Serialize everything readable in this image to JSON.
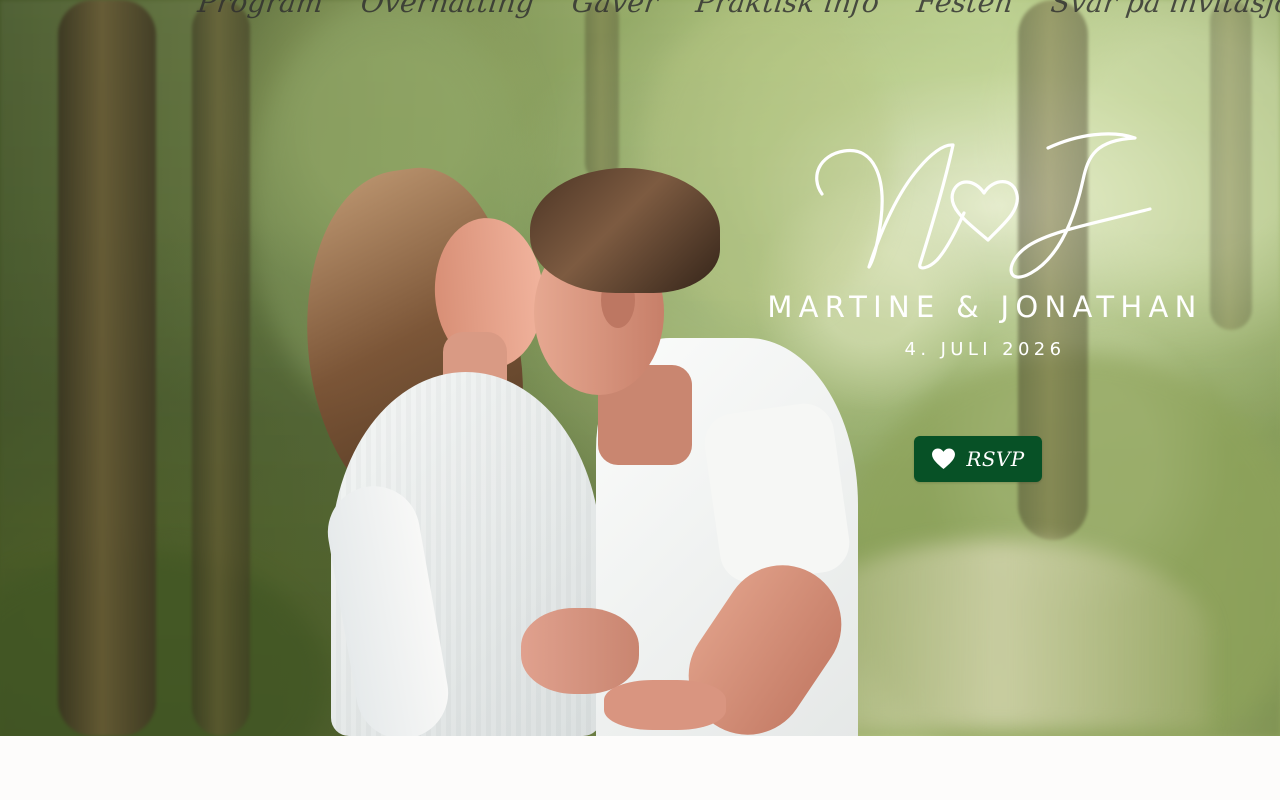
{
  "navigation": {
    "items": [
      {
        "label": "Program"
      },
      {
        "label": "Overnatting"
      },
      {
        "label": "Gaver"
      },
      {
        "label": "Praktisk info"
      },
      {
        "label": "Festen"
      },
      {
        "label": "Svar på invitasjon"
      }
    ]
  },
  "hero": {
    "monogram": "M♡J",
    "names": "MARTINE & JONATHAN",
    "date": "4. JULI 2026",
    "rsvp_label": "RSVP",
    "rsvp_icon": "heart-icon"
  },
  "colors": {
    "rsvp_button": "#075126",
    "hero_text": "#ffffff",
    "navigation_text": "#2f2f2f",
    "page_background": "#fdfcfb"
  }
}
